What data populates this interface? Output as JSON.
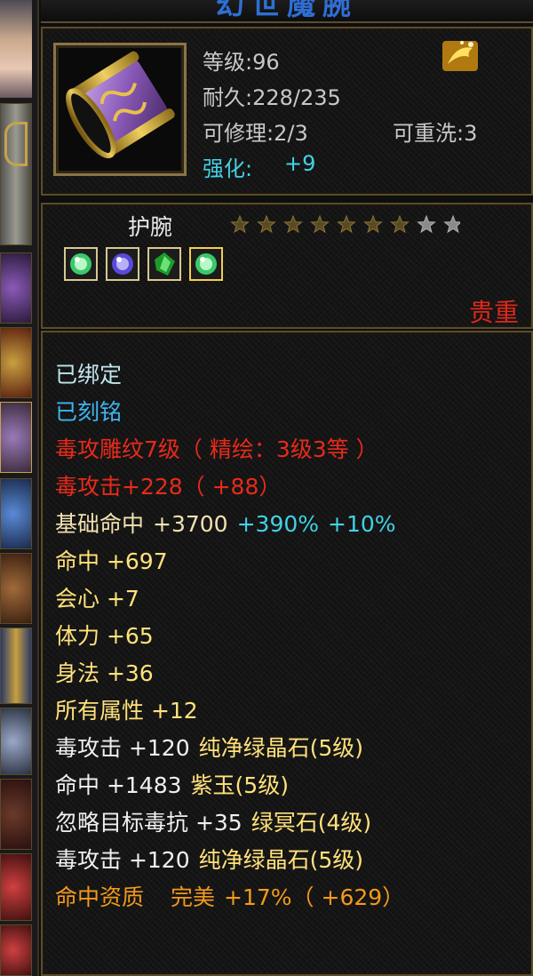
{
  "item": {
    "title": "幻世魔腕",
    "level_label": "等级:96",
    "durability_label": "耐久:228/235",
    "repair_label": "可修理:2/3",
    "rewash_label": "可重洗:3",
    "enhance_label": "强化:",
    "enhance_value": "+9",
    "name": "护腕",
    "stars_total": 9,
    "stars_filled": 7,
    "rarity": "贵重"
  },
  "gems": [
    "green-crystal-gem-icon",
    "purple-jade-gem-icon",
    "green-dark-gem-icon",
    "green-crystal-gem-icon"
  ],
  "attributes": {
    "bound": "已绑定",
    "engraved": "已刻铭",
    "carving": "毒攻雕纹7级（ 精绘：3级3等 ）",
    "poison_attack": "毒攻击+228（ +88）",
    "base_hit_label": "基础命中",
    "base_hit_value": "+3700",
    "base_hit_pct1": "+390%",
    "base_hit_pct2": "+10%",
    "hit": "命中 +697",
    "crit": "会心 +7",
    "vitality": "体力 +65",
    "agility": "身法 +36",
    "all_attr": "所有属性 +12",
    "gem1_stat": "毒攻击 +120",
    "gem1_name": "纯净绿晶石(5级)",
    "gem2_stat": "命中 +1483",
    "gem2_name": "紫玉(5级)",
    "gem3_stat": "忽略目标毒抗 +35",
    "gem3_name": "绿冥石(4级)",
    "gem4_stat": "毒攻击 +120",
    "gem4_name": "纯净绿晶石(5级)",
    "aptitude_label": "命中资质",
    "aptitude_grade": "完美",
    "aptitude_value": "+17%（ +629）"
  },
  "colors": {
    "frame": "#5b4c2c",
    "bound": "#bfe6ee",
    "engraved": "#3fb4f0",
    "red": "#e82a1a",
    "cyan": "#41d2e6",
    "yellow": "#ffe27a",
    "orange": "#f39a1a"
  }
}
